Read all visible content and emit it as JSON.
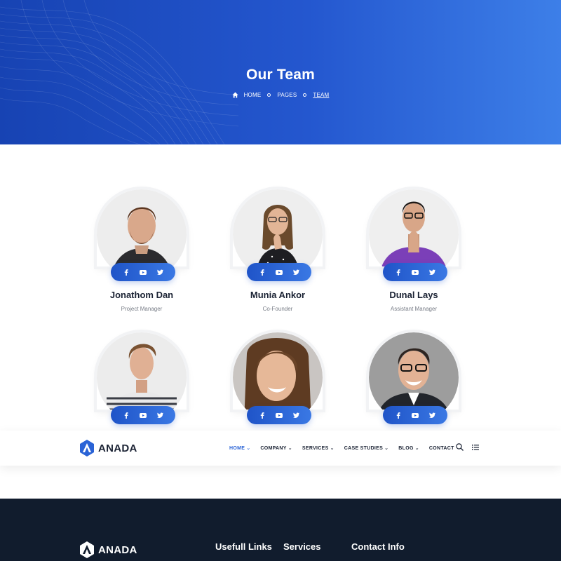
{
  "hero": {
    "title": "Our Team",
    "breadcrumb": [
      {
        "label": "HOME",
        "icon": "home-icon"
      },
      {
        "label": "PAGES"
      },
      {
        "label": "TEAM",
        "current": true
      }
    ],
    "gradient": [
      "#1743b3",
      "#3d7fe8"
    ]
  },
  "team": [
    {
      "name": "Jonathom Dan",
      "role": "Project Manager",
      "avatar": "avatar-man-beard-black-sweater"
    },
    {
      "name": "Munia Ankor",
      "role": "Co-Founder",
      "avatar": "avatar-woman-glasses-polka-dot"
    },
    {
      "name": "Dunal Lays",
      "role": "Assistant Manager",
      "avatar": "avatar-man-glasses-purple-shirt"
    },
    {
      "name": "",
      "role": "",
      "avatar": "avatar-man-striped-shirt"
    },
    {
      "name": "",
      "role": "",
      "avatar": "avatar-woman-smiling"
    },
    {
      "name": "",
      "role": "",
      "avatar": "avatar-man-glasses-suit"
    }
  ],
  "social_icons": [
    "facebook-icon",
    "youtube-icon",
    "twitter-icon"
  ],
  "navbar": {
    "logo": "ANADA",
    "items": [
      {
        "label": "HOME",
        "active": true,
        "dropdown": true
      },
      {
        "label": "COMPANY",
        "dropdown": true
      },
      {
        "label": "SERVICES",
        "dropdown": true
      },
      {
        "label": "CASE STUDIES",
        "dropdown": true
      },
      {
        "label": "BLOG",
        "dropdown": true
      },
      {
        "label": "CONTACT",
        "dropdown": false
      }
    ],
    "tools": [
      "search-icon",
      "list-menu-icon"
    ],
    "accent": "#2a63d6"
  },
  "footer": {
    "logo": "ANADA",
    "headings": {
      "links": "Usefull Links",
      "services": "Services",
      "contact": "Contact Info"
    },
    "background": "#111c2d"
  }
}
